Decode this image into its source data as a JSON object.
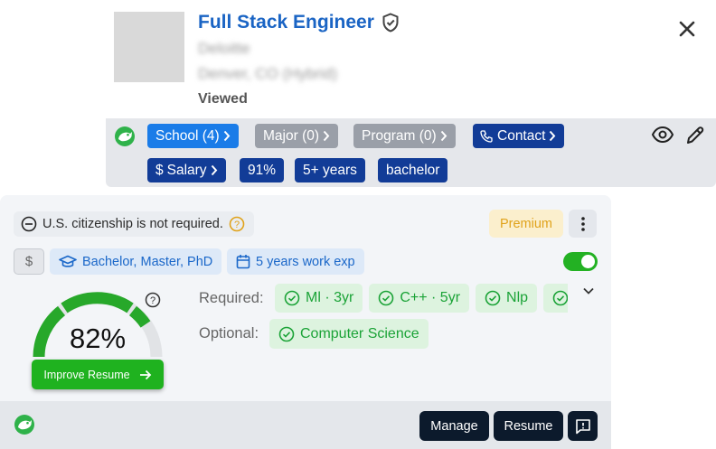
{
  "job": {
    "title": "Full Stack Engineer",
    "company": "Deloitte",
    "location": "Denver, CO (Hybrid)",
    "status": "Viewed"
  },
  "tags": {
    "school": "School (4)",
    "major": "Major (0)",
    "program": "Program (0)",
    "contact": "Contact",
    "salary": "Salary",
    "match": "91%",
    "experience": "5+ years",
    "degree": "bachelor"
  },
  "panel": {
    "citizenship": "U.S. citizenship is not required.",
    "premium_label": "Premium",
    "salary_symbol": "$",
    "education": "Bachelor, Master, PhD",
    "work_exp": "5 years work exp",
    "toggle_on": true,
    "match_percent": "82%",
    "match_value": 82,
    "improve_label": "Improve Resume",
    "required_label": "Required:",
    "required_skills": [
      "Ml · 3yr",
      "C++ · 5yr",
      "Nlp"
    ],
    "optional_label": "Optional:",
    "optional_skills": [
      "Computer Science"
    ]
  },
  "footer": {
    "manage_label": "Manage",
    "resume_label": "Resume"
  },
  "colors": {
    "link_blue": "#1a64c4",
    "tag_blue": "#1a7ce8",
    "tag_grey": "#9a9fa8",
    "tag_navy": "#123c97",
    "success_green": "#1fb21f",
    "premium_gold": "#e0a21a",
    "dark_button": "#0c1a2c"
  },
  "icons": {
    "verified": "shield-check-icon",
    "close": "close-icon",
    "view": "eye-icon",
    "edit": "pencil-icon",
    "contact": "phone-icon",
    "education": "graduation-cap-icon",
    "calendar": "calendar-icon",
    "feedback": "message-alert-icon"
  }
}
